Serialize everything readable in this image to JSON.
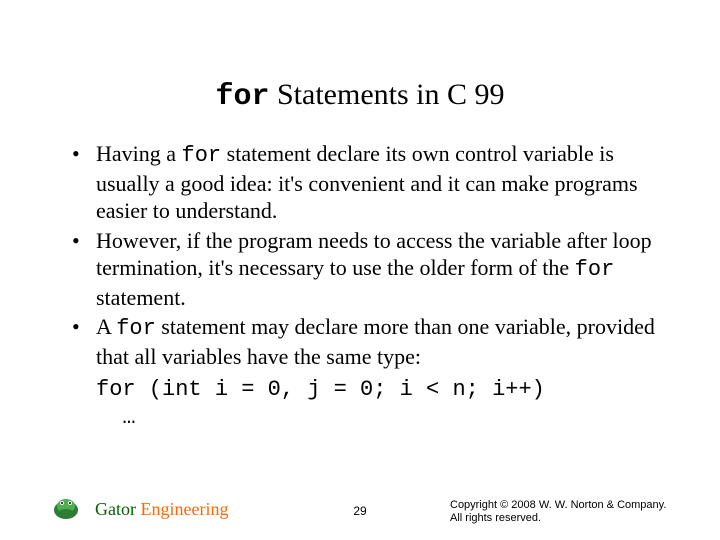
{
  "title": {
    "code": "for",
    "rest": " Statements in C 99"
  },
  "bullets": [
    {
      "pre": "Having a ",
      "code": "for",
      "post": " statement declare its own control variable is usually a good idea: it's convenient and it can make programs easier to understand."
    },
    {
      "pre": "However, if the program needs to access the variable after loop termination, it's necessary to use the older form of the ",
      "code": "for",
      "post": " statement."
    },
    {
      "pre": "A ",
      "code": "for",
      "post": " statement may declare more than one variable, provided that all variables have the same type:"
    }
  ],
  "codeblock": "for (int i = 0, j = 0; i < n; i++)\n  …",
  "footer": {
    "brand1": "Gator ",
    "brand2": "Engineering",
    "page": "29",
    "copyright1": "Copyright © 2008 W. W. Norton & Company.",
    "copyright2": "All rights reserved."
  }
}
